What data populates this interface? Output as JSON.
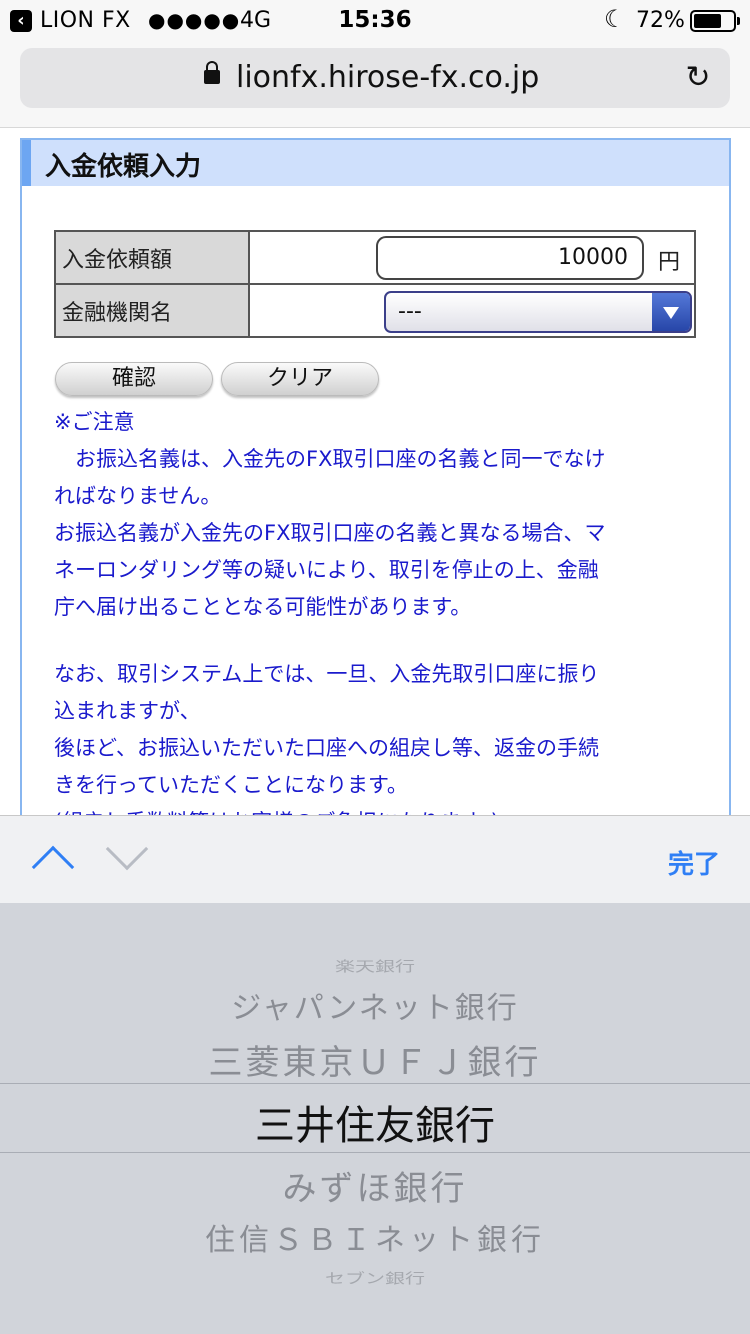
{
  "status_bar": {
    "back_app": "LION FX",
    "signal": "●●●●●",
    "network": "4G",
    "time": "15:36",
    "battery": "72%",
    "battery_level": 0.72
  },
  "browser": {
    "url": "lionfx.hirose-fx.co.jp"
  },
  "page": {
    "title": "入金依頼入力",
    "amount_label": "入金依頼額",
    "amount_value": "10000",
    "amount_unit": "円",
    "bank_label": "金融機関名",
    "bank_selected": "---",
    "confirm_button": "確認",
    "clear_button": "クリア",
    "notice": {
      "heading": "※ご注意",
      "lines": [
        "　お振込名義は、入金先のFX取引口座の名義と同一でなけ",
        "ればなりません。",
        "お振込名義が入金先のFX取引口座の名義と異なる場合、マ",
        "ネーロンダリング等の疑いにより、取引を停止の上、金融",
        "庁へ届け出ることとなる可能性があります。",
        "なお、取引システム上では、一旦、入金先取引口座に振り",
        "込まれますが、",
        "後ほど、お振込いただいた口座への組戻し等、返金の手続",
        "きを行っていただくことになります。",
        "(組戻し手数料等はお客様のご負担になります。)"
      ]
    }
  },
  "keyboard": {
    "done_label": "完了"
  },
  "picker": {
    "items": [
      "楽天銀行",
      "ジャパンネット銀行",
      "三菱東京ＵＦＪ銀行",
      "三井住友銀行",
      "みずほ銀行",
      "住信ＳＢＩネット銀行",
      "セブン銀行"
    ],
    "selected_index": 3
  },
  "icons": {
    "back": "chevron-left-icon",
    "lock": "lock-icon",
    "reload": "reload-icon",
    "prev": "chevron-up-icon",
    "next": "chevron-down-icon"
  },
  "colors": {
    "link_blue": "#2f7ff5",
    "notice_blue": "#1a1acc",
    "panel_header": "#cfe0fc"
  }
}
